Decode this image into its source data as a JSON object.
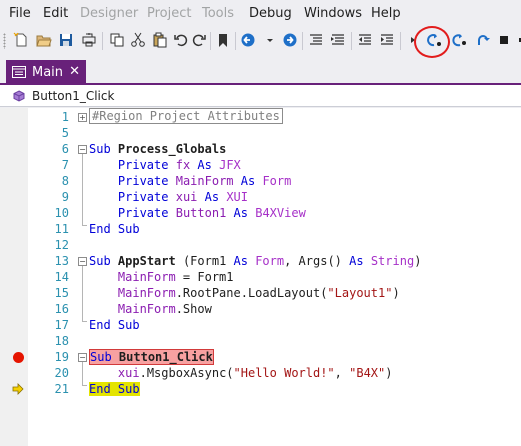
{
  "menu": {
    "items": [
      {
        "label": "File",
        "enabled": true
      },
      {
        "label": "Edit",
        "enabled": true
      },
      {
        "label": "Designer",
        "enabled": false
      },
      {
        "label": "Project",
        "enabled": false
      },
      {
        "label": "Tools",
        "enabled": false
      },
      {
        "label": "Debug",
        "enabled": true
      },
      {
        "label": "Windows",
        "enabled": true
      },
      {
        "label": "Help",
        "enabled": true
      }
    ]
  },
  "toolbar": {
    "icons": [
      "new-file-icon",
      "open-folder-icon",
      "save-icon",
      "print-icon",
      "copy-icon",
      "cut-icon",
      "paste-icon",
      "undo-icon",
      "redo-icon",
      "bookmark-icon",
      "navigate-back-icon",
      "navigate-forward-icon",
      "comment-icon",
      "uncomment-icon",
      "outdent-icon",
      "indent-icon",
      "step-icon",
      "step-over-icon",
      "step-into-icon",
      "step-out-icon",
      "stop-icon"
    ],
    "highlighted_icon": "step-over-icon"
  },
  "tabs": [
    {
      "label": "Main",
      "active": true,
      "close": "✕"
    }
  ],
  "navbar": {
    "label": "Button1_Click",
    "icon": "sub-icon"
  },
  "editor": {
    "lines": [
      {
        "n": "1",
        "text": "#Region Project Attributes"
      },
      {
        "n": "5",
        "text": ""
      },
      {
        "n": "6",
        "text": "Sub Process_Globals"
      },
      {
        "n": "7",
        "text": "    Private fx As JFX"
      },
      {
        "n": "8",
        "text": "    Private MainForm As Form"
      },
      {
        "n": "9",
        "text": "    Private xui As XUI"
      },
      {
        "n": "10",
        "text": "    Private Button1 As B4XView"
      },
      {
        "n": "11",
        "text": "End Sub"
      },
      {
        "n": "12",
        "text": ""
      },
      {
        "n": "13",
        "text": "Sub AppStart (Form1 As Form, Args() As String)"
      },
      {
        "n": "14",
        "text": "    MainForm = Form1"
      },
      {
        "n": "15",
        "text": "    MainForm.RootPane.LoadLayout(\"Layout1\")"
      },
      {
        "n": "16",
        "text": "    MainForm.Show"
      },
      {
        "n": "17",
        "text": "End Sub"
      },
      {
        "n": "18",
        "text": ""
      },
      {
        "n": "19",
        "text": "Sub Button1_Click"
      },
      {
        "n": "20",
        "text": "    xui.MsgboxAsync(\"Hello World!\", \"B4X\")"
      },
      {
        "n": "21",
        "text": "End Sub"
      }
    ],
    "breakpoint_line": "19",
    "current_line": "21"
  },
  "colors": {
    "accent": "#68217a",
    "breakpoint": "#e51400",
    "current_line": "#e4e400",
    "keyword": "#0000d8",
    "identifier": "#8b1db1",
    "string": "#a31515",
    "line_number": "#2b91af",
    "annotation": "#e21c1c"
  }
}
